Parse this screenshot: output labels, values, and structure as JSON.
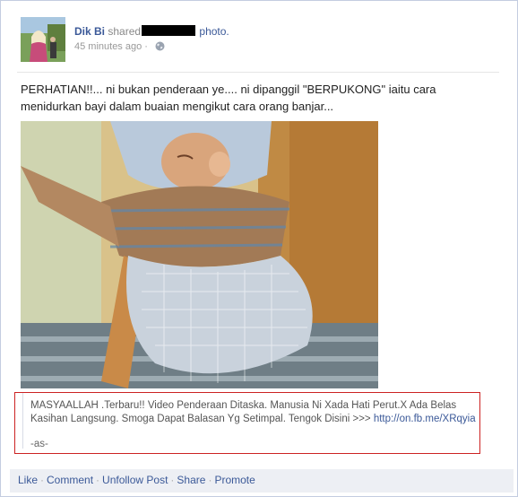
{
  "post": {
    "author": "Dik Bi",
    "shared_text": "shared",
    "photo_label": "photo.",
    "timestamp": "45 minutes ago",
    "separator": "·",
    "caption": "PERHATIAN!!... ni bukan penderaan ye.... ni dipanggil \"BERPUKONG\" iaitu cara menidurkan bayi dalam buaian mengikut cara orang banjar..."
  },
  "shared_message": {
    "text": "MASYAALLAH .Terbaru!! Video Penderaan Ditaska. Manusia Ni Xada Hati Perut.X Ada Belas Kasihan Langsung. Smoga Dapat Balasan Yg Setimpal. Tengok Disini >>> ",
    "link": "http://on.fb.me/XRqyia",
    "signature": "-as-"
  },
  "actions": {
    "like": "Like",
    "comment": "Comment",
    "unfollow": "Unfollow Post",
    "share": "Share",
    "promote": "Promote",
    "dot": "·"
  },
  "colors": {
    "link": "#3b5998",
    "highlight_border": "#cc2222",
    "action_bar": "#edeff4"
  },
  "icons": {
    "privacy": "globe-icon"
  }
}
